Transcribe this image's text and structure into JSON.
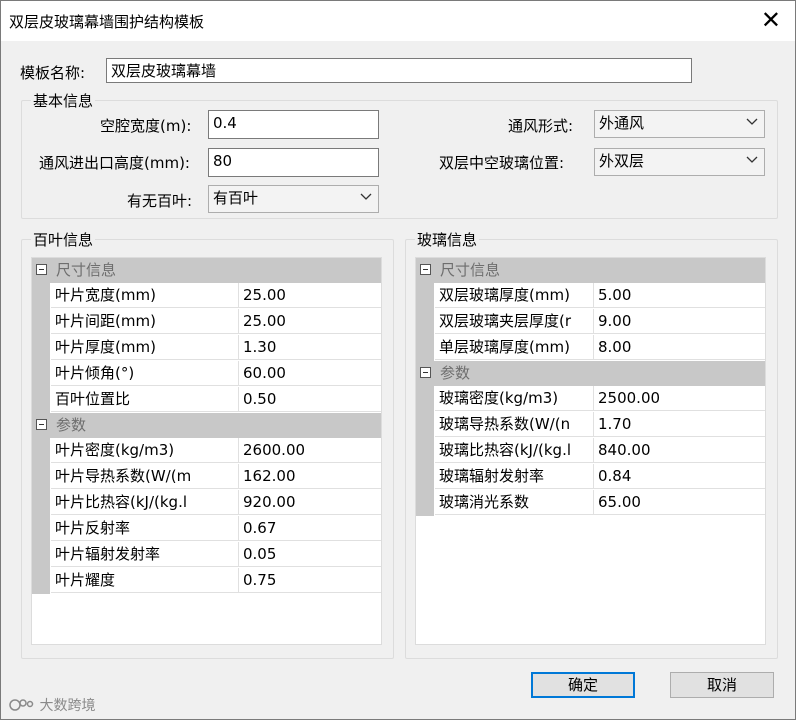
{
  "window": {
    "title": "双层皮玻璃幕墙围护结构模板",
    "close_glyph": "✕"
  },
  "template_name": {
    "label": "模板名称:",
    "value": "双层皮玻璃幕墙"
  },
  "basic_info": {
    "title": "基本信息",
    "cavity_width": {
      "label": "空腔宽度(m):",
      "value": "0.4"
    },
    "vent_height": {
      "label": "通风进出口高度(mm):",
      "value": "80"
    },
    "has_louver": {
      "label": "有无百叶:",
      "value": "有百叶"
    },
    "vent_type": {
      "label": "通风形式:",
      "value": "外通风"
    },
    "glass_position": {
      "label": "双层中空玻璃位置:",
      "value": "外双层"
    }
  },
  "louver_info": {
    "title": "百叶信息",
    "categories": [
      {
        "name": "尺寸信息",
        "rows": [
          {
            "name": "叶片宽度(mm)",
            "value": "25.00"
          },
          {
            "name": "叶片间距(mm)",
            "value": "25.00"
          },
          {
            "name": "叶片厚度(mm)",
            "value": "1.30"
          },
          {
            "name": "叶片倾角(°)",
            "value": "60.00"
          },
          {
            "name": "百叶位置比",
            "value": "0.50"
          }
        ]
      },
      {
        "name": "参数",
        "rows": [
          {
            "name": "叶片密度(kg/m3)",
            "value": "2600.00"
          },
          {
            "name": "叶片导热系数(W/(m",
            "value": "162.00"
          },
          {
            "name": "叶片比热容(kJ/(kg.l",
            "value": "920.00"
          },
          {
            "name": "叶片反射率",
            "value": "0.67"
          },
          {
            "name": "叶片辐射发射率",
            "value": "0.05"
          },
          {
            "name": "叶片耀度",
            "value": "0.75"
          }
        ]
      }
    ]
  },
  "glass_info": {
    "title": "玻璃信息",
    "categories": [
      {
        "name": "尺寸信息",
        "rows": [
          {
            "name": "双层玻璃厚度(mm)",
            "value": "5.00"
          },
          {
            "name": "双层玻璃夹层厚度(r",
            "value": "9.00"
          },
          {
            "name": "单层玻璃厚度(mm)",
            "value": "8.00"
          }
        ]
      },
      {
        "name": "参数",
        "rows": [
          {
            "name": "玻璃密度(kg/m3)",
            "value": "2500.00"
          },
          {
            "name": "玻璃导热系数(W/(n",
            "value": "1.70"
          },
          {
            "name": "玻璃比热容(kJ/(kg.l",
            "value": "840.00"
          },
          {
            "name": "玻璃辐射发射率",
            "value": "0.84"
          },
          {
            "name": "玻璃消光系数",
            "value": "65.00"
          }
        ]
      }
    ]
  },
  "buttons": {
    "ok": "确定",
    "cancel": "取消"
  },
  "watermark": "大数跨境"
}
